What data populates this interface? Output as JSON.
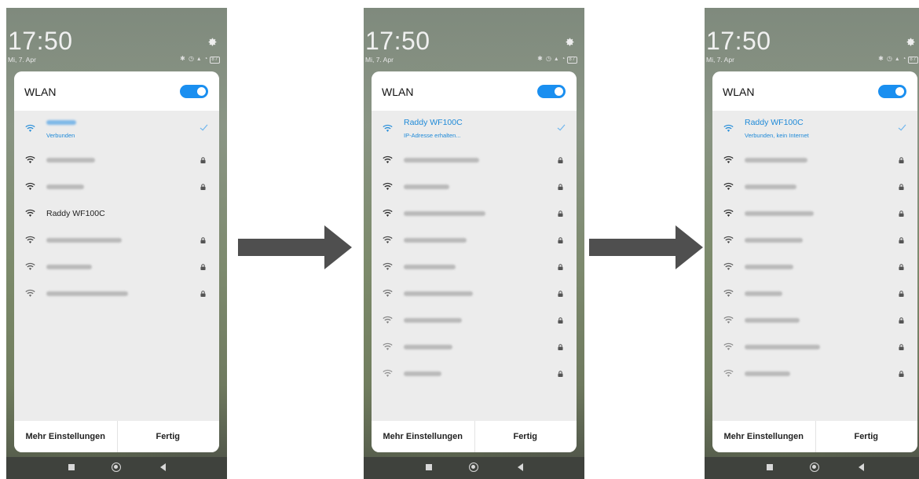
{
  "status_bar": {
    "time": "17:50",
    "date": "Mi, 7. Apr",
    "battery": "87"
  },
  "panel": {
    "title": "WLAN",
    "toggle_on": true
  },
  "footer": {
    "more_settings": "Mehr Einstellungen",
    "done": "Fertig"
  },
  "screens": [
    {
      "connected": {
        "name": "",
        "status": "Verbunden"
      },
      "networks": [
        {
          "name": "",
          "secured": true
        },
        {
          "name": "",
          "secured": true
        },
        {
          "name": "Raddy WF100C",
          "secured": false
        },
        {
          "name": "",
          "secured": true
        },
        {
          "name": "",
          "secured": true
        },
        {
          "name": "",
          "secured": true
        }
      ]
    },
    {
      "connected": {
        "name": "Raddy WF100C",
        "status": "IP-Adresse erhalten..."
      },
      "networks": [
        {
          "name": "",
          "secured": true
        },
        {
          "name": "",
          "secured": true
        },
        {
          "name": "",
          "secured": true
        },
        {
          "name": "",
          "secured": true
        },
        {
          "name": "",
          "secured": true
        },
        {
          "name": "",
          "secured": true
        },
        {
          "name": "",
          "secured": true
        },
        {
          "name": "",
          "secured": true
        },
        {
          "name": "",
          "secured": true
        }
      ]
    },
    {
      "connected": {
        "name": "Raddy WF100C",
        "status": "Verbunden, kein Internet"
      },
      "networks": [
        {
          "name": "",
          "secured": true
        },
        {
          "name": "",
          "secured": true
        },
        {
          "name": "",
          "secured": true
        },
        {
          "name": "",
          "secured": true
        },
        {
          "name": "",
          "secured": true
        },
        {
          "name": "",
          "secured": true
        },
        {
          "name": "",
          "secured": true
        },
        {
          "name": "",
          "secured": true
        },
        {
          "name": "",
          "secured": true
        }
      ]
    }
  ],
  "colors": {
    "accent": "#1a8ff0",
    "arrow": "#4f4f4f",
    "panel": "#ececec"
  }
}
